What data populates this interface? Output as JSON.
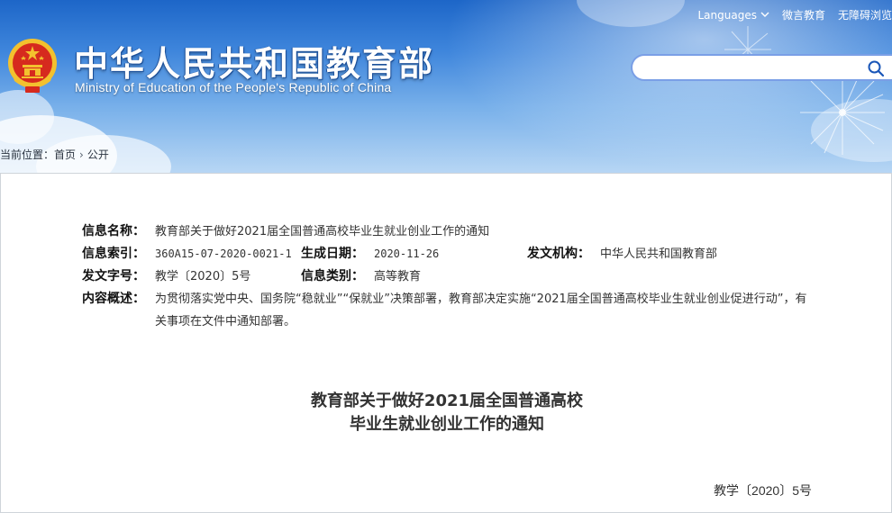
{
  "header": {
    "title": "中华人民共和国教育部",
    "subtitle": "Ministry of Education of the People's Republic of China",
    "links": {
      "languages": "Languages",
      "weibo": "微言教育",
      "accessibility": "无障碍浏览"
    },
    "search": {
      "placeholder": ""
    }
  },
  "breadcrumb": {
    "prefix": "当前位置：",
    "home": "首页",
    "current": "公开"
  },
  "info": {
    "name_label": "信息名称：",
    "name_value": "教育部关于做好2021届全国普通高校毕业生就业创业工作的通知",
    "index_label": "信息索引：",
    "index_value": "360A15-07-2020-0021-1",
    "date_label": "生成日期：",
    "date_value": "2020-11-26",
    "agency_label": "发文机构：",
    "agency_value": "中华人民共和国教育部",
    "docno_label": "发文字号：",
    "docno_value": "教学〔2020〕5号",
    "category_label": "信息类别：",
    "category_value": "高等教育",
    "summary_label": "内容概述：",
    "summary_value": "为贯彻落实党中央、国务院“稳就业”“保就业”决策部署，教育部决定实施“2021届全国普通高校毕业生就业创业促进行动”，有关事项在文件中通知部署。"
  },
  "document": {
    "title_line1": "教育部关于做好2021届全国普通高校",
    "title_line2": "毕业生就业创业工作的通知",
    "number": "教学〔2020〕5号"
  },
  "colors": {
    "header_blue": "#1d66c8",
    "search_border": "#7a9fe6",
    "emblem_red": "#d62a1e",
    "emblem_gold": "#f3c12e"
  }
}
